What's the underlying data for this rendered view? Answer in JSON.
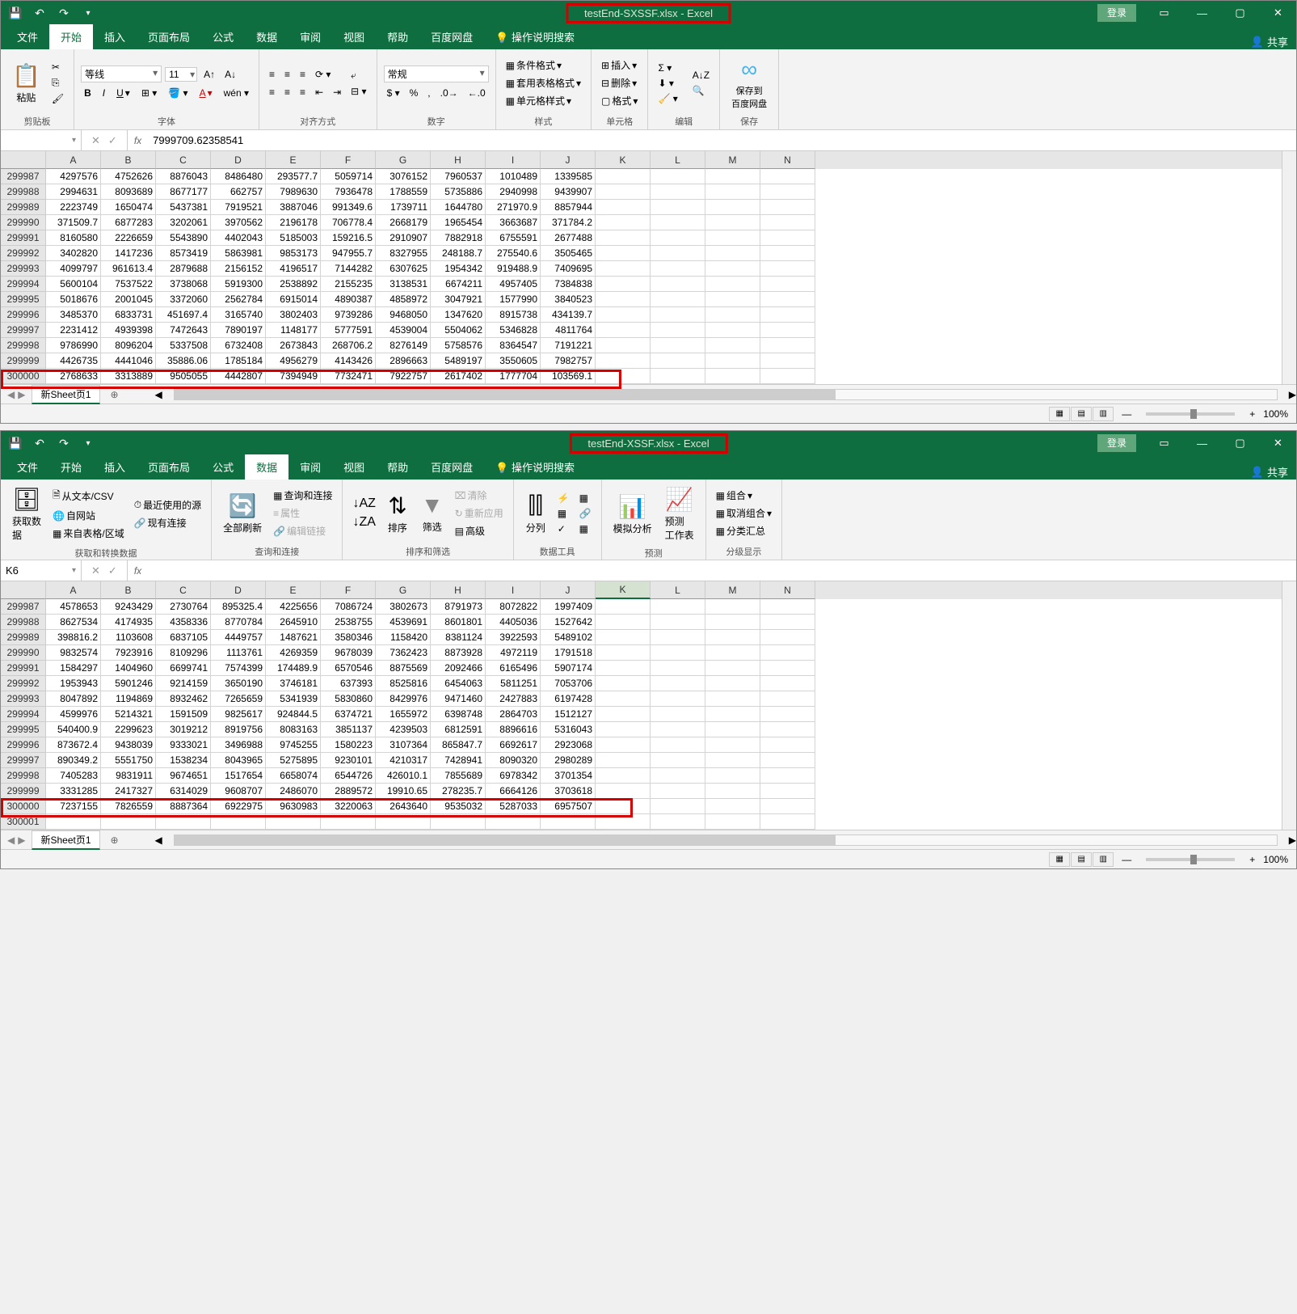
{
  "win1": {
    "title": "testEnd-SXSSF.xlsx - Excel",
    "login": "登录",
    "tabs": {
      "file": "文件",
      "home": "开始",
      "insert": "插入",
      "layout": "页面布局",
      "formulas": "公式",
      "data": "数据",
      "review": "审阅",
      "view": "视图",
      "help": "帮助",
      "baidu": "百度网盘",
      "tell": "操作说明搜索"
    },
    "share": "共享",
    "ribbon": {
      "paste": "粘贴",
      "clipboard": "剪贴板",
      "font": "等线",
      "size": "11",
      "fontgrp": "字体",
      "align": "对齐方式",
      "wrap": "常规",
      "number": "数字",
      "cond": "条件格式",
      "table": "套用表格格式",
      "cellstyle": "单元格样式",
      "styles": "样式",
      "insertbtn": "插入",
      "deletebtn": "删除",
      "formatbtn": "格式",
      "cells": "单元格",
      "editing": "编辑",
      "savecloud": "保存到\n百度网盘",
      "save": "保存"
    },
    "formula_bar": {
      "name": "",
      "value": "7999709.62358541"
    },
    "columns": [
      "A",
      "B",
      "C",
      "D",
      "E",
      "F",
      "G",
      "H",
      "I",
      "J",
      "K",
      "L",
      "M",
      "N"
    ],
    "rows": [
      {
        "n": "299987",
        "v": [
          "4297576",
          "4752626",
          "8876043",
          "8486480",
          "293577.7",
          "5059714",
          "3076152",
          "7960537",
          "1010489",
          "1339585",
          "",
          "",
          "",
          ""
        ]
      },
      {
        "n": "299988",
        "v": [
          "2994631",
          "8093689",
          "8677177",
          "662757",
          "7989630",
          "7936478",
          "1788559",
          "5735886",
          "2940998",
          "9439907",
          "",
          "",
          "",
          ""
        ]
      },
      {
        "n": "299989",
        "v": [
          "2223749",
          "1650474",
          "5437381",
          "7919521",
          "3887046",
          "991349.6",
          "1739711",
          "1644780",
          "271970.9",
          "8857944",
          "",
          "",
          "",
          ""
        ]
      },
      {
        "n": "299990",
        "v": [
          "371509.7",
          "6877283",
          "3202061",
          "3970562",
          "2196178",
          "706778.4",
          "2668179",
          "1965454",
          "3663687",
          "371784.2",
          "",
          "",
          "",
          ""
        ]
      },
      {
        "n": "299991",
        "v": [
          "8160580",
          "2226659",
          "5543890",
          "4402043",
          "5185003",
          "159216.5",
          "2910907",
          "7882918",
          "6755591",
          "2677488",
          "",
          "",
          "",
          ""
        ]
      },
      {
        "n": "299992",
        "v": [
          "3402820",
          "1417236",
          "8573419",
          "5863981",
          "9853173",
          "947955.7",
          "8327955",
          "248188.7",
          "275540.6",
          "3505465",
          "",
          "",
          "",
          ""
        ]
      },
      {
        "n": "299993",
        "v": [
          "4099797",
          "961613.4",
          "2879688",
          "2156152",
          "4196517",
          "7144282",
          "6307625",
          "1954342",
          "919488.9",
          "7409695",
          "",
          "",
          "",
          ""
        ]
      },
      {
        "n": "299994",
        "v": [
          "5600104",
          "7537522",
          "3738068",
          "5919300",
          "2538892",
          "2155235",
          "3138531",
          "6674211",
          "4957405",
          "7384838",
          "",
          "",
          "",
          ""
        ]
      },
      {
        "n": "299995",
        "v": [
          "5018676",
          "2001045",
          "3372060",
          "2562784",
          "6915014",
          "4890387",
          "4858972",
          "3047921",
          "1577990",
          "3840523",
          "",
          "",
          "",
          ""
        ]
      },
      {
        "n": "299996",
        "v": [
          "3485370",
          "6833731",
          "451697.4",
          "3165740",
          "3802403",
          "9739286",
          "9468050",
          "1347620",
          "8915738",
          "434139.7",
          "",
          "",
          "",
          ""
        ]
      },
      {
        "n": "299997",
        "v": [
          "2231412",
          "4939398",
          "7472643",
          "7890197",
          "1148177",
          "5777591",
          "4539004",
          "5504062",
          "5346828",
          "4811764",
          "",
          "",
          "",
          ""
        ]
      },
      {
        "n": "299998",
        "v": [
          "9786990",
          "8096204",
          "5337508",
          "6732408",
          "2673843",
          "268706.2",
          "8276149",
          "5758576",
          "8364547",
          "7191221",
          "",
          "",
          "",
          ""
        ]
      },
      {
        "n": "299999",
        "v": [
          "4426735",
          "4441046",
          "35886.06",
          "1785184",
          "4956279",
          "4143426",
          "2896663",
          "5489197",
          "3550605",
          "7982757",
          "",
          "",
          "",
          ""
        ]
      },
      {
        "n": "300000",
        "v": [
          "2768633",
          "3313889",
          "9505055",
          "4442807",
          "7394949",
          "7732471",
          "7922757",
          "2617402",
          "1777704",
          "103569.1",
          "",
          "",
          "",
          ""
        ]
      }
    ],
    "sheet": "新Sheet页1",
    "zoom": "100%"
  },
  "win2": {
    "title": "testEnd-XSSF.xlsx - Excel",
    "login": "登录",
    "tabs": {
      "file": "文件",
      "home": "开始",
      "insert": "插入",
      "layout": "页面布局",
      "formulas": "公式",
      "data": "数据",
      "review": "审阅",
      "view": "视图",
      "help": "帮助",
      "baidu": "百度网盘",
      "tell": "操作说明搜索"
    },
    "share": "共享",
    "ribbon": {
      "getdata": "获取数\n据",
      "csv": "从文本/CSV",
      "web": "自网站",
      "table": "来自表格/区域",
      "recent": "最近使用的源",
      "conn": "现有连接",
      "getgrp": "获取和转换数据",
      "refresh": "全部刷新",
      "queries": "查询和连接",
      "props": "属性",
      "links": "编辑链接",
      "querygrp": "查询和连接",
      "sortaz": "A↓Z",
      "sortza": "Z↓A",
      "sort": "排序",
      "filter": "筛选",
      "clear": "清除",
      "reapply": "重新应用",
      "advanced": "高级",
      "sortgrp": "排序和筛选",
      "texttocol": "分列",
      "toolsgrp": "数据工具",
      "whatif": "模拟分析",
      "forecast": "预测\n工作表",
      "forecastgrp": "预测",
      "group": "组合",
      "ungroup": "取消组合",
      "subtotal": "分类汇总",
      "outlinegrp": "分级显示"
    },
    "formula_bar": {
      "name": "K6",
      "value": ""
    },
    "columns": [
      "A",
      "B",
      "C",
      "D",
      "E",
      "F",
      "G",
      "H",
      "I",
      "J",
      "K",
      "L",
      "M",
      "N"
    ],
    "rows": [
      {
        "n": "299987",
        "v": [
          "4578653",
          "9243429",
          "2730764",
          "895325.4",
          "4225656",
          "7086724",
          "3802673",
          "8791973",
          "8072822",
          "1997409",
          "",
          "",
          "",
          ""
        ]
      },
      {
        "n": "299988",
        "v": [
          "8627534",
          "4174935",
          "4358336",
          "8770784",
          "2645910",
          "2538755",
          "4539691",
          "8601801",
          "4405036",
          "1527642",
          "",
          "",
          "",
          ""
        ]
      },
      {
        "n": "299989",
        "v": [
          "398816.2",
          "1103608",
          "6837105",
          "4449757",
          "1487621",
          "3580346",
          "1158420",
          "8381124",
          "3922593",
          "5489102",
          "",
          "",
          "",
          ""
        ]
      },
      {
        "n": "299990",
        "v": [
          "9832574",
          "7923916",
          "8109296",
          "1113761",
          "4269359",
          "9678039",
          "7362423",
          "8873928",
          "4972119",
          "1791518",
          "",
          "",
          "",
          ""
        ]
      },
      {
        "n": "299991",
        "v": [
          "1584297",
          "1404960",
          "6699741",
          "7574399",
          "174489.9",
          "6570546",
          "8875569",
          "2092466",
          "6165496",
          "5907174",
          "",
          "",
          "",
          ""
        ]
      },
      {
        "n": "299992",
        "v": [
          "1953943",
          "5901246",
          "9214159",
          "3650190",
          "3746181",
          "637393",
          "8525816",
          "6454063",
          "5811251",
          "7053706",
          "",
          "",
          "",
          ""
        ]
      },
      {
        "n": "299993",
        "v": [
          "8047892",
          "1194869",
          "8932462",
          "7265659",
          "5341939",
          "5830860",
          "8429976",
          "9471460",
          "2427883",
          "6197428",
          "",
          "",
          "",
          ""
        ]
      },
      {
        "n": "299994",
        "v": [
          "4599976",
          "5214321",
          "1591509",
          "9825617",
          "924844.5",
          "6374721",
          "1655972",
          "6398748",
          "2864703",
          "1512127",
          "",
          "",
          "",
          ""
        ]
      },
      {
        "n": "299995",
        "v": [
          "540400.9",
          "2299623",
          "3019212",
          "8919756",
          "8083163",
          "3851137",
          "4239503",
          "6812591",
          "8896616",
          "5316043",
          "",
          "",
          "",
          ""
        ]
      },
      {
        "n": "299996",
        "v": [
          "873672.4",
          "9438039",
          "9333021",
          "3496988",
          "9745255",
          "1580223",
          "3107364",
          "865847.7",
          "6692617",
          "2923068",
          "",
          "",
          "",
          ""
        ]
      },
      {
        "n": "299997",
        "v": [
          "890349.2",
          "5551750",
          "1538234",
          "8043965",
          "5275895",
          "9230101",
          "4210317",
          "7428941",
          "8090320",
          "2980289",
          "",
          "",
          "",
          ""
        ]
      },
      {
        "n": "299998",
        "v": [
          "7405283",
          "9831911",
          "9674651",
          "1517654",
          "6658074",
          "6544726",
          "426010.1",
          "7855689",
          "6978342",
          "3701354",
          "",
          "",
          "",
          ""
        ]
      },
      {
        "n": "299999",
        "v": [
          "3331285",
          "2417327",
          "6314029",
          "9608707",
          "2486070",
          "2889572",
          "19910.65",
          "278235.7",
          "6664126",
          "3703618",
          "",
          "",
          "",
          ""
        ]
      },
      {
        "n": "300000",
        "v": [
          "7237155",
          "7826559",
          "8887364",
          "6922975",
          "9630983",
          "3220063",
          "2643640",
          "9535032",
          "5287033",
          "6957507",
          "",
          "",
          "",
          ""
        ]
      },
      {
        "n": "300001",
        "v": [
          "",
          "",
          "",
          "",
          "",
          "",
          "",
          "",
          "",
          "",
          "",
          "",
          "",
          ""
        ]
      }
    ],
    "sheet": "新Sheet页1",
    "zoom": "100%"
  }
}
